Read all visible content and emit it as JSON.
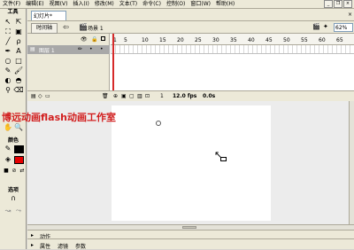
{
  "menubar": {
    "items": [
      "文件(F)",
      "编辑(E)",
      "视图(V)",
      "插入(I)",
      "修改(M)",
      "文本(T)",
      "命令(C)",
      "控制(O)",
      "窗口(W)",
      "帮助(H)"
    ]
  },
  "tools": {
    "title": "工具",
    "colors_label": "颜色",
    "options_label": "选项",
    "stroke_color": "#000000",
    "fill_color": "#e60000"
  },
  "document": {
    "tab_label": "幻灯片*",
    "timeline_button": "时间轴",
    "scene_label": "场景 1",
    "zoom": "62%"
  },
  "timeline": {
    "ruler_ticks": [
      "1",
      "5",
      "10",
      "15",
      "20",
      "25",
      "30",
      "35",
      "40",
      "45",
      "50",
      "55",
      "60",
      "65"
    ],
    "layer_name": "图层 1",
    "current_frame": "1",
    "fps": "12.0 fps",
    "elapsed": "0.0s"
  },
  "stage": {
    "watermark": "博远动画flash动画工作室"
  },
  "panels": {
    "actions": "动作",
    "properties_tabs": [
      "属性",
      "滤镜",
      "参数"
    ]
  },
  "colors": {
    "accent_red": "#d21f1f"
  }
}
